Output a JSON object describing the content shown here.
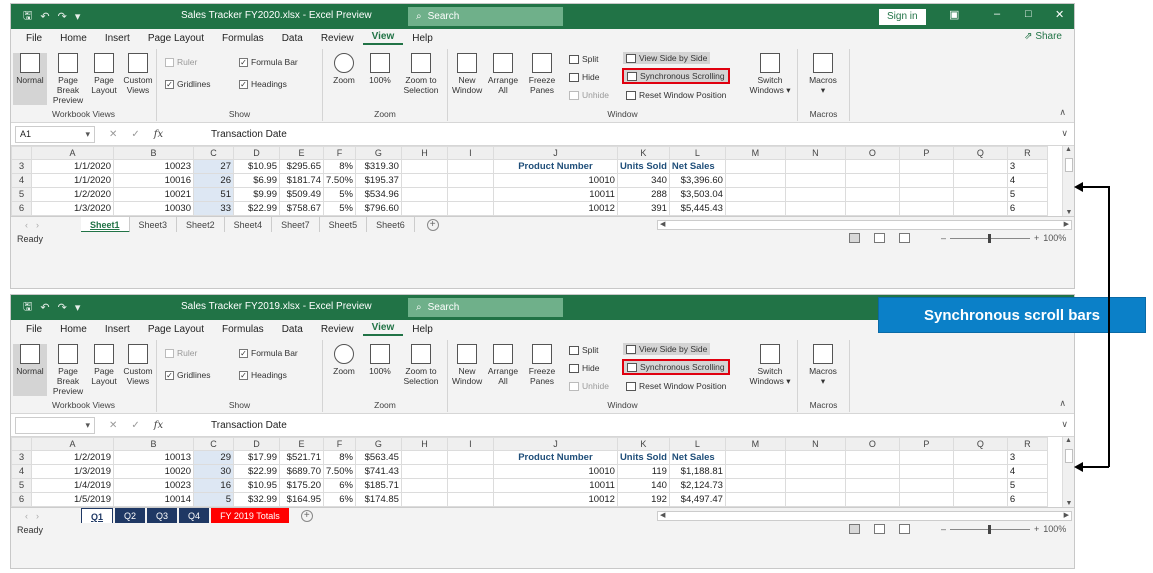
{
  "annotation": {
    "callout": "Synchronous scroll bars"
  },
  "ribbon_common": {
    "menu": [
      "File",
      "Home",
      "Insert",
      "Page Layout",
      "Formulas",
      "Data",
      "Review",
      "View",
      "Help"
    ],
    "share": "Share",
    "sign_in": "Sign in",
    "search": "Search",
    "workbook_views": {
      "normal": "Normal",
      "page_break": "Page Break Preview",
      "page_layout": "Page Layout",
      "custom": "Custom Views",
      "label": "Workbook Views"
    },
    "show": {
      "ruler": "Ruler",
      "formula_bar": "Formula Bar",
      "gridlines": "Gridlines",
      "headings": "Headings",
      "label": "Show"
    },
    "zoom": {
      "zoom": "Zoom",
      "hundred": "100%",
      "zoom_sel": "Zoom to Selection",
      "label": "Zoom"
    },
    "window": {
      "new_window": "New Window",
      "arrange_all": "Arrange All",
      "freeze": "Freeze Panes",
      "split": "Split",
      "hide": "Hide",
      "unhide": "Unhide",
      "side_by_side": "View Side by Side",
      "sync_scroll": "Synchronous Scrolling",
      "reset": "Reset Window Position",
      "switch": "Switch Windows",
      "label": "Window"
    },
    "macros": {
      "macros": "Macros",
      "label": "Macros"
    },
    "formula_text": "Transaction Date",
    "columns": [
      "A",
      "B",
      "C",
      "D",
      "E",
      "F",
      "G",
      "H",
      "I",
      "J",
      "K",
      "L",
      "M",
      "N",
      "O",
      "P",
      "Q",
      "R"
    ],
    "status": "Ready",
    "zoom_level": "100%"
  },
  "window1": {
    "title": "Sales Tracker FY2020.xlsx  -  Excel Preview",
    "name_box": "A1",
    "rows": [
      {
        "r": "3",
        "a": "1/1/2020",
        "b": "10023",
        "c": "27",
        "d": "$10.95",
        "e": "$295.65",
        "f": "8%",
        "g": "$319.30",
        "j": "Product Number",
        "k": "Units Sold",
        "l": "Net Sales"
      },
      {
        "r": "4",
        "a": "1/1/2020",
        "b": "10016",
        "c": "26",
        "d": "$6.99",
        "e": "$181.74",
        "f": "7.50%",
        "g": "$195.37",
        "j": "10010",
        "k": "340",
        "l": "$3,396.60"
      },
      {
        "r": "5",
        "a": "1/2/2020",
        "b": "10021",
        "c": "51",
        "d": "$9.99",
        "e": "$509.49",
        "f": "5%",
        "g": "$534.96",
        "j": "10011",
        "k": "288",
        "l": "$3,503.04"
      },
      {
        "r": "6",
        "a": "1/3/2020",
        "b": "10030",
        "c": "33",
        "d": "$22.99",
        "e": "$758.67",
        "f": "5%",
        "g": "$796.60",
        "j": "10012",
        "k": "391",
        "l": "$5,445.43"
      }
    ],
    "tabs": [
      "Sheet1",
      "Sheet3",
      "Sheet2",
      "Sheet4",
      "Sheet7",
      "Sheet5",
      "Sheet6"
    ]
  },
  "window2": {
    "title": "Sales Tracker FY2019.xlsx  -  Excel Preview",
    "name_box": "",
    "rows": [
      {
        "r": "3",
        "a": "1/2/2019",
        "b": "10013",
        "c": "29",
        "d": "$17.99",
        "e": "$521.71",
        "f": "8%",
        "g": "$563.45",
        "j": "Product Number",
        "k": "Units Sold",
        "l": "Net Sales"
      },
      {
        "r": "4",
        "a": "1/3/2019",
        "b": "10020",
        "c": "30",
        "d": "$22.99",
        "e": "$689.70",
        "f": "7.50%",
        "g": "$741.43",
        "j": "10010",
        "k": "119",
        "l": "$1,188.81"
      },
      {
        "r": "5",
        "a": "1/4/2019",
        "b": "10023",
        "c": "16",
        "d": "$10.95",
        "e": "$175.20",
        "f": "6%",
        "g": "$185.71",
        "j": "10011",
        "k": "140",
        "l": "$2,124.73"
      },
      {
        "r": "6",
        "a": "1/5/2019",
        "b": "10014",
        "c": "5",
        "d": "$32.99",
        "e": "$164.95",
        "f": "6%",
        "g": "$174.85",
        "j": "10012",
        "k": "192",
        "l": "$4,497.47"
      }
    ],
    "tabs": [
      "Q1",
      "Q2",
      "Q3",
      "Q4",
      "FY 2019 Totals"
    ]
  }
}
